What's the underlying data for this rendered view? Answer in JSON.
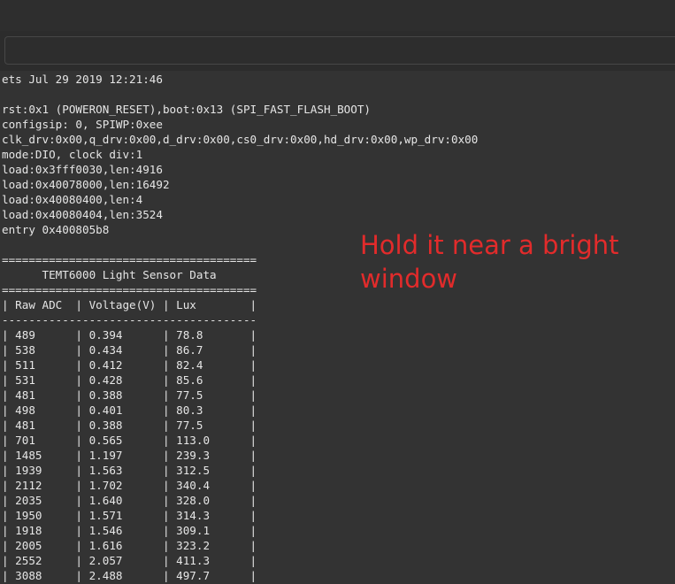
{
  "input": {
    "value": ""
  },
  "boot_log": [
    "ets Jul 29 2019 12:21:46",
    "",
    "rst:0x1 (POWERON_RESET),boot:0x13 (SPI_FAST_FLASH_BOOT)",
    "configsip: 0, SPIWP:0xee",
    "clk_drv:0x00,q_drv:0x00,d_drv:0x00,cs0_drv:0x00,hd_drv:0x00,wp_drv:0x00",
    "mode:DIO, clock div:1",
    "load:0x3fff0030,len:4916",
    "load:0x40078000,len:16492",
    "load:0x40080400,len:4",
    "load:0x40080404,len:3524",
    "entry 0x400805b8",
    ""
  ],
  "sensor_table": {
    "rule_double": "======================================",
    "title": "TEMT6000 Light Sensor Data",
    "rule_dash": "--------------------------------------",
    "columns": [
      "Raw ADC",
      "Voltage(V)",
      "Lux"
    ],
    "rows": [
      [
        "489",
        "0.394",
        "78.8"
      ],
      [
        "538",
        "0.434",
        "86.7"
      ],
      [
        "511",
        "0.412",
        "82.4"
      ],
      [
        "531",
        "0.428",
        "85.6"
      ],
      [
        "481",
        "0.388",
        "77.5"
      ],
      [
        "498",
        "0.401",
        "80.3"
      ],
      [
        "481",
        "0.388",
        "77.5"
      ],
      [
        "701",
        "0.565",
        "113.0"
      ],
      [
        "1485",
        "1.197",
        "239.3"
      ],
      [
        "1939",
        "1.563",
        "312.5"
      ],
      [
        "2112",
        "1.702",
        "340.4"
      ],
      [
        "2035",
        "1.640",
        "328.0"
      ],
      [
        "1950",
        "1.571",
        "314.3"
      ],
      [
        "1918",
        "1.546",
        "309.1"
      ],
      [
        "2005",
        "1.616",
        "323.2"
      ],
      [
        "2552",
        "2.057",
        "411.3"
      ],
      [
        "3088",
        "2.488",
        "497.7"
      ]
    ]
  },
  "annotation": {
    "text": "Hold it near a bright window",
    "color": "#e22b2b"
  }
}
